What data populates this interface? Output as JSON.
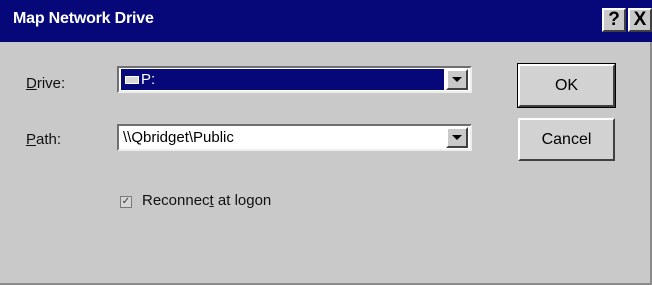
{
  "window": {
    "title": "Map Network Drive",
    "help_label": "?",
    "close_label": "X"
  },
  "drive": {
    "label_prefix": "D",
    "label_rest": "rive:",
    "value": "P:"
  },
  "path": {
    "label_prefix": "P",
    "label_rest": "ath:",
    "value": "\\\\Qbridget\\Public"
  },
  "buttons": {
    "ok_label": "OK",
    "cancel_label": "Cancel"
  },
  "reconnect": {
    "label_part1": "Reconnec",
    "label_underlined": "t",
    "label_part2": " at logon",
    "checked": true,
    "check_glyph": "✓"
  }
}
